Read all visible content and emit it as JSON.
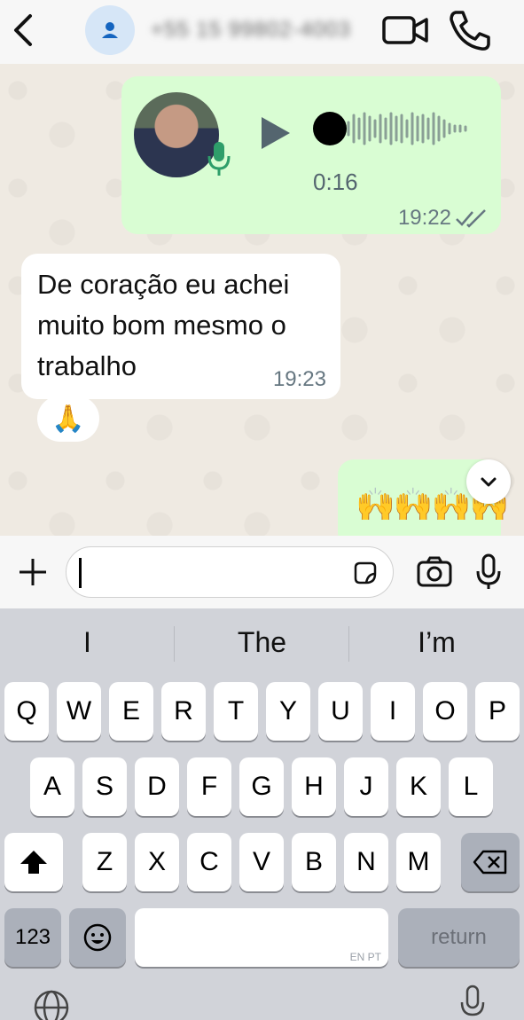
{
  "header": {
    "contact_name": "+55 15 99802-4003",
    "icons": [
      "back-chevron-icon",
      "profile-person-icon",
      "video-call-icon",
      "phone-call-icon"
    ]
  },
  "messages": {
    "audio": {
      "duration": "0:16",
      "time": "19:22",
      "status": "read"
    },
    "incoming": {
      "text": "De coração eu achei muito bom mesmo o trabalho",
      "time": "19:23",
      "reaction": "🙏"
    },
    "emoji_message": "🙌🙌🙌🙌"
  },
  "input": {
    "value": "",
    "placeholder": ""
  },
  "keyboard": {
    "suggestions": [
      "I",
      "The",
      "I’m"
    ],
    "row1": [
      "Q",
      "W",
      "E",
      "R",
      "T",
      "Y",
      "U",
      "I",
      "O",
      "P"
    ],
    "row2": [
      "A",
      "S",
      "D",
      "F",
      "G",
      "H",
      "J",
      "K",
      "L"
    ],
    "row3": [
      "Z",
      "X",
      "C",
      "V",
      "B",
      "N",
      "M"
    ],
    "numbers_key": "123",
    "return_key": "return",
    "space_lang": "EN PT"
  },
  "colors": {
    "bubble_out": "#d9fdd3",
    "bubble_in": "#ffffff",
    "chat_bg": "#efeae2",
    "keyboard_bg": "#d1d3d9"
  }
}
